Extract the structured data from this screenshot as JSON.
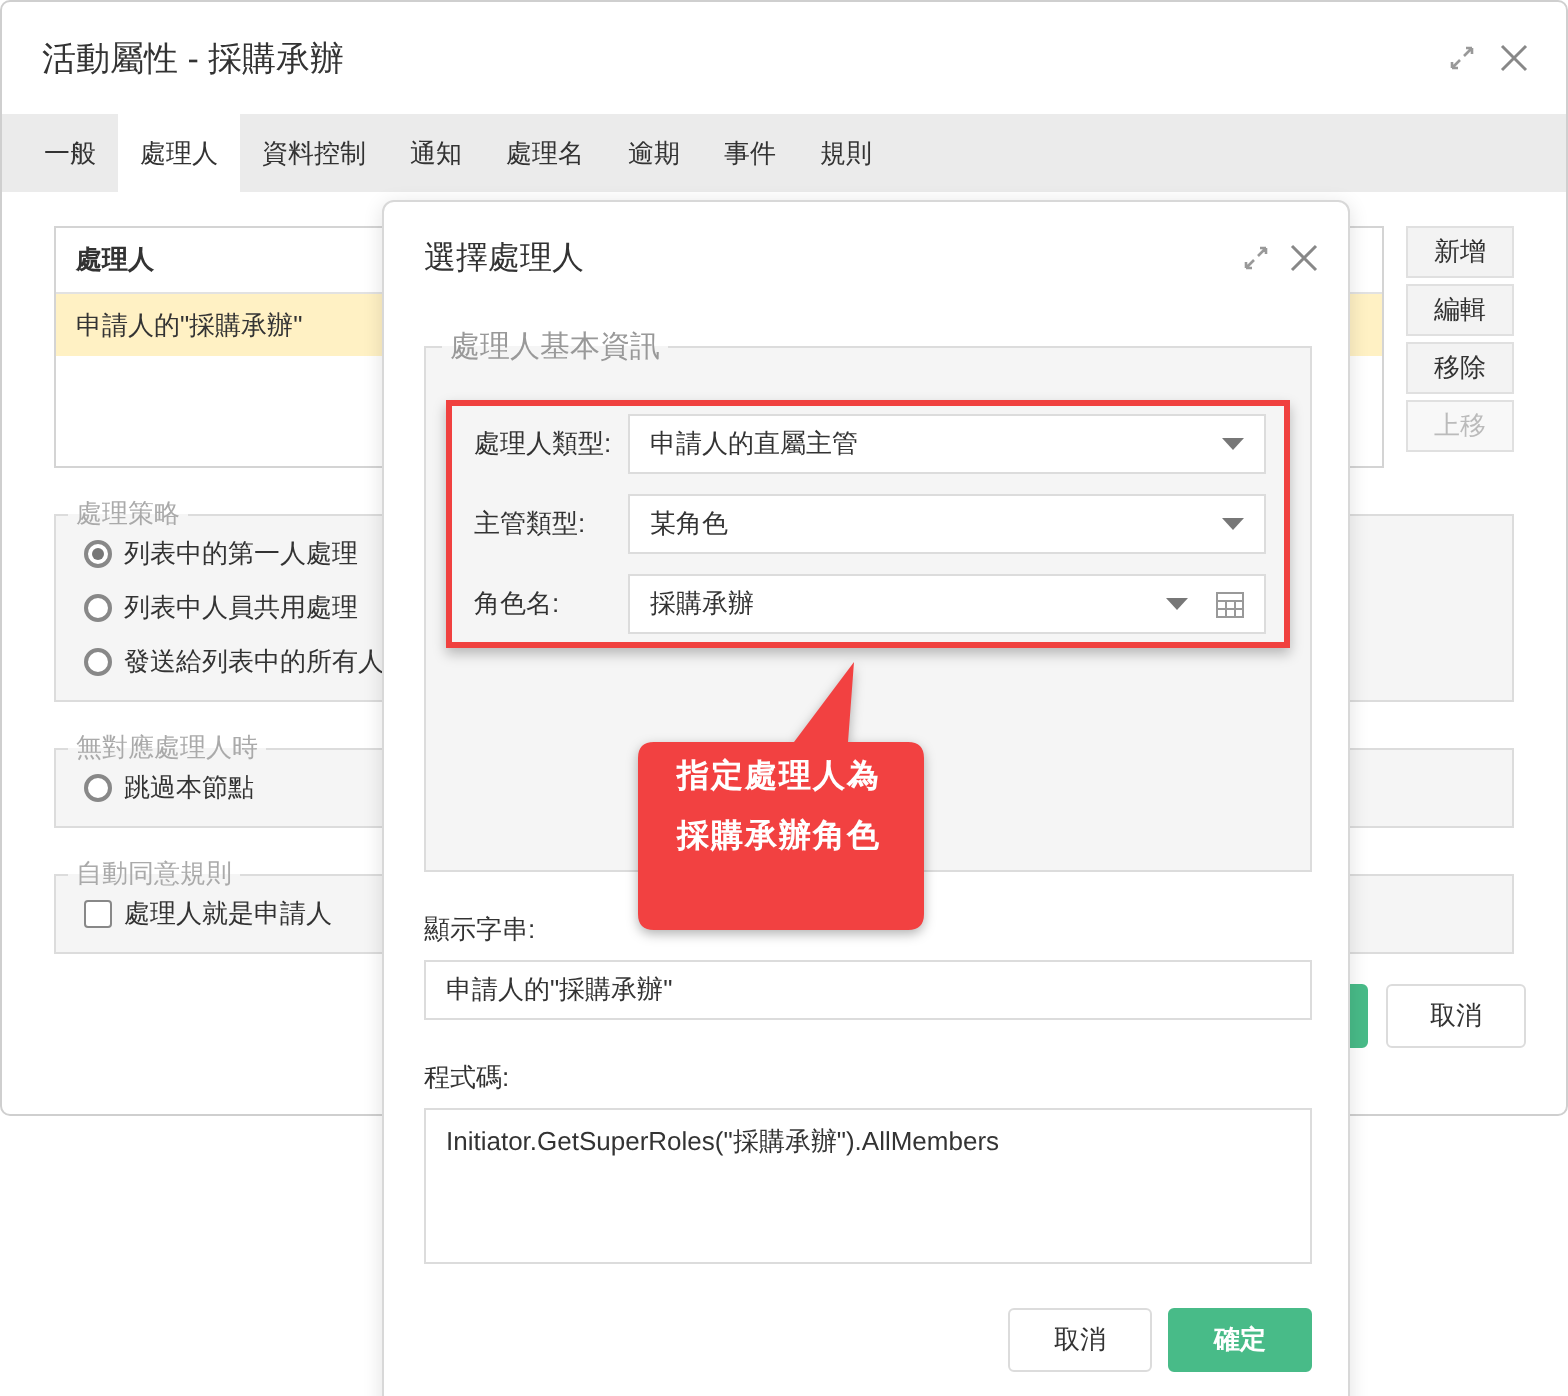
{
  "window": {
    "title": "活動屬性 - 採購承辦"
  },
  "tabs": [
    {
      "label": "一般",
      "selected": false
    },
    {
      "label": "處理人",
      "selected": true
    },
    {
      "label": "資料控制",
      "selected": false
    },
    {
      "label": "通知",
      "selected": false
    },
    {
      "label": "處理名",
      "selected": false
    },
    {
      "label": "逾期",
      "selected": false
    },
    {
      "label": "事件",
      "selected": false
    },
    {
      "label": "規則",
      "selected": false
    }
  ],
  "handler_table": {
    "columns": [
      "處理人"
    ],
    "rows": [
      {
        "cells": [
          "申請人的\"採購承辦\""
        ],
        "selected": true
      }
    ]
  },
  "side_buttons": [
    {
      "label": "新增",
      "disabled": false
    },
    {
      "label": "編輯",
      "disabled": false
    },
    {
      "label": "移除",
      "disabled": false
    },
    {
      "label": "上移",
      "disabled": true
    }
  ],
  "groups": [
    {
      "title": "處理策略",
      "options": [
        {
          "kind": "radio",
          "label": "列表中的第一人處理",
          "checked": true
        },
        {
          "kind": "radio",
          "label": "列表中人員共用處理",
          "checked": false
        },
        {
          "kind": "radio",
          "label": "發送給列表中的所有人",
          "checked": false
        }
      ]
    },
    {
      "title": "無對應處理人時",
      "options": [
        {
          "kind": "radio",
          "label": "跳過本節點",
          "checked": false
        }
      ]
    },
    {
      "title": "自動同意規則",
      "options": [
        {
          "kind": "checkbox",
          "label": "處理人就是申請人",
          "checked": false
        }
      ]
    }
  ],
  "footer_buttons": [
    {
      "kind": "primary"
    },
    {
      "kind": "secondary",
      "label": "取消"
    }
  ],
  "dialog": {
    "title": "選擇處理人",
    "legend": "處理人基本資訊",
    "fields": [
      {
        "kind": "select",
        "label": "處理人類型:",
        "value": "申請人的直屬主管"
      },
      {
        "kind": "select",
        "label": "主管類型:",
        "value": "某角色"
      },
      {
        "kind": "picker",
        "label": "角色名:",
        "value": "採購承辦"
      }
    ],
    "display": {
      "label": "顯示字串:",
      "value": "申請人的\"採購承辦\""
    },
    "code": {
      "label": "程式碼:",
      "value": "Initiator.GetSuperRoles(\"採購承辦\").AllMembers"
    },
    "buttons": [
      {
        "kind": "secondary",
        "label": "取消"
      },
      {
        "kind": "primary",
        "label": "確定"
      }
    ]
  },
  "callout": {
    "lines": [
      "指定處理人為",
      "採購承辦角色"
    ]
  }
}
